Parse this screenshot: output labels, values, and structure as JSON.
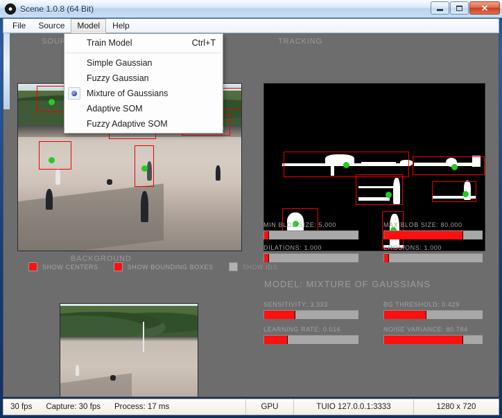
{
  "window": {
    "title": "Scene 1.0.8 (64 Bit)",
    "icon": "circle-dot-icon",
    "minimize_label": "",
    "maximize_label": "",
    "close_label": "✕"
  },
  "menubar": {
    "items": [
      {
        "label": "File",
        "open": false
      },
      {
        "label": "Source",
        "open": false
      },
      {
        "label": "Model",
        "open": true
      },
      {
        "label": "Help",
        "open": false
      }
    ]
  },
  "dropdown": {
    "owner": "Model",
    "items": [
      {
        "label": "Train Model",
        "accel": "Ctrl+T",
        "selected": false
      },
      {
        "label": "Simple Gaussian",
        "accel": "",
        "selected": false
      },
      {
        "label": "Fuzzy Gaussian",
        "accel": "",
        "selected": false
      },
      {
        "label": "Mixture of Gaussians",
        "accel": "",
        "selected": true
      },
      {
        "label": "Adaptive SOM",
        "accel": "",
        "selected": false
      },
      {
        "label": "Fuzzy Adaptive SOM",
        "accel": "",
        "selected": false
      }
    ]
  },
  "panels": {
    "source_header": "SOURCE",
    "tracking_header": "TRACKING",
    "background_header": "BACKGROUND"
  },
  "toggles": [
    {
      "label": "SHOW CENTERS",
      "checked": true
    },
    {
      "label": "SHOW BOUNDING BOXES",
      "checked": true
    },
    {
      "label": "SHOW IDS",
      "checked": false
    }
  ],
  "blob_sliders": [
    {
      "label": "MIN BLOB SIZE: 5.000",
      "name": "min-blob-size",
      "value": 5.0,
      "fill_pct": 5
    },
    {
      "label": "MAX BLOB SIZE: 80.000",
      "name": "max-blob-size",
      "value": 80.0,
      "fill_pct": 80
    },
    {
      "label": "DILATIONS: 1.000",
      "name": "dilations",
      "value": 1.0,
      "fill_pct": 5
    },
    {
      "label": "EROSIONS: 1.000",
      "name": "erosions",
      "value": 1.0,
      "fill_pct": 5
    }
  ],
  "model": {
    "section_title": "MODEL: MIXTURE OF GAUSSIANS",
    "sliders": [
      {
        "label": "SENSITIVITY: 3.333",
        "name": "sensitivity",
        "value": 3.333,
        "fill_pct": 33
      },
      {
        "label": "BG THRESHOLD: 0.429",
        "name": "bg-threshold",
        "value": 0.429,
        "fill_pct": 43
      },
      {
        "label": "LEARNING RATE: 0.016",
        "name": "learning-rate",
        "value": 0.016,
        "fill_pct": 25
      },
      {
        "label": "NOISE VARIANCE: 80.784",
        "name": "noise-variance",
        "value": 80.784,
        "fill_pct": 80
      }
    ]
  },
  "statusbar": {
    "fps": "30 fps",
    "capture": "Capture:  30 fps",
    "process": "Process:  17 ms",
    "device": "GPU",
    "tuio": "TUIO 127.0.0.1:3333",
    "resolution": "1280 x 720"
  },
  "colors": {
    "accent_red": "#ff0f0f",
    "center_green": "#22cc22",
    "panel_gray": "#6d6d6d",
    "label_gray": "#a3a3a3"
  }
}
